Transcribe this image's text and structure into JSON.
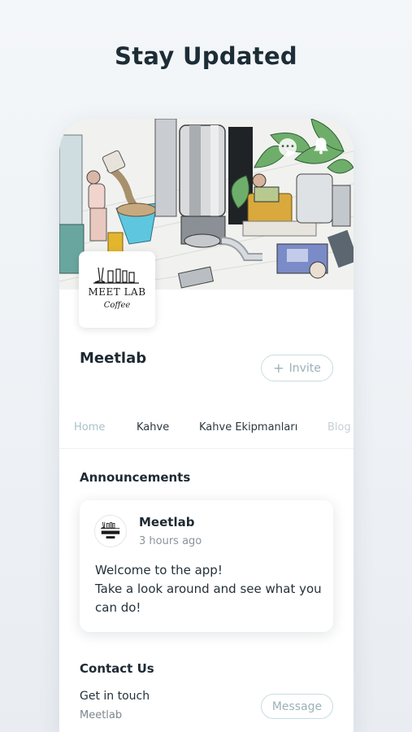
{
  "headline": "Stay Updated",
  "cover": {
    "logo": {
      "line1": "MEET LAB",
      "line2": "Coffee"
    }
  },
  "group": {
    "name": "Meetlab",
    "invite_label": "Invite"
  },
  "tabs": [
    {
      "label": "Home",
      "active": true
    },
    {
      "label": "Kahve",
      "active": false
    },
    {
      "label": "Kahve Ekipmanları",
      "active": false
    },
    {
      "label": "Blog",
      "active": false
    }
  ],
  "announcements": {
    "title": "Announcements",
    "post": {
      "author": "Meetlab",
      "time": "3 hours ago",
      "body_line1": "Welcome to the app!",
      "body_line2": "Take a look around and see what you can do!"
    }
  },
  "contact": {
    "title": "Contact Us",
    "line": "Get in touch",
    "sub": "Meetlab",
    "message_label": "Message"
  },
  "colors": {
    "accent": "#a9c2c8",
    "button_border": "#c9dcdf",
    "button_text": "#9bb1b8",
    "heading": "#1d2d36"
  }
}
